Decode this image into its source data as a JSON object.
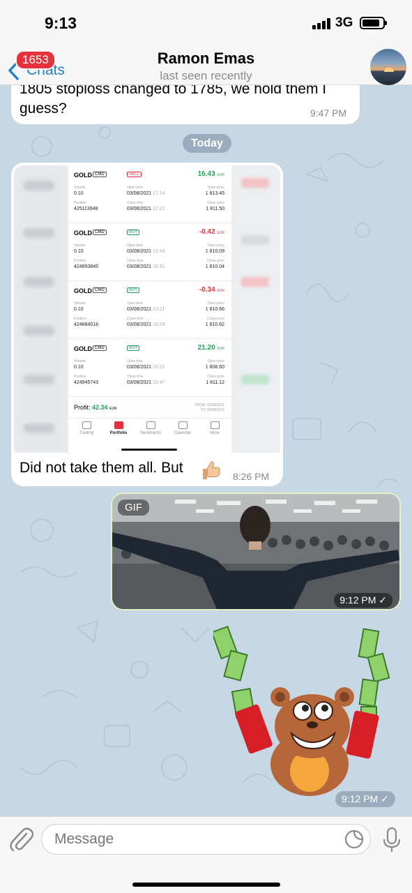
{
  "status_bar": {
    "time": "9:13",
    "network": "3G",
    "battery_level": 0.85
  },
  "header": {
    "back_label": "Chats",
    "unread_count": "1653",
    "title": "Ramon Emas",
    "subtitle": "last seen recently",
    "icons": {
      "back": "chevron-left-icon",
      "avatar": "sunset-photo"
    }
  },
  "messages": {
    "partial": {
      "text": "1805 stoploss changed to 1785, we hold them I guess?",
      "time": "9:47 PM"
    },
    "date_separator": "Today",
    "image_message": {
      "caption": "Did not take them all. But",
      "emoji": "thumbs-up-icon",
      "time": "8:26 PM",
      "screenshot": {
        "trades": [
          {
            "instrument": "GOLD",
            "type": "CMD",
            "side": "SELL",
            "pnl": "16.43",
            "currency": "EUR",
            "pnl_positive": true,
            "volume_label": "Volume",
            "volume": "0.10",
            "position_label": "Position",
            "position": "425113948",
            "open_time_label": "Open time",
            "open_date": "03/08/2021",
            "open_clock": "17:14",
            "close_time_label": "Close time",
            "close_date": "03/08/2021",
            "close_clock": "17:22",
            "open_price_label": "Open price",
            "open_price": "1 813.45",
            "close_price_label": "Close price",
            "close_price": "1 811.50"
          },
          {
            "instrument": "GOLD",
            "type": "CMD",
            "side": "BUY",
            "pnl": "-0.42",
            "currency": "EUR",
            "pnl_positive": false,
            "volume_label": "Volume",
            "volume": "0.10",
            "position_label": "Position",
            "position": "424893845",
            "open_time_label": "Open time",
            "open_date": "03/08/2021",
            "open_clock": "13:44",
            "close_time_label": "Close time",
            "close_date": "03/08/2021",
            "close_clock": "16:31",
            "open_price_label": "Open price",
            "open_price": "1 810.09",
            "close_price_label": "Close price",
            "close_price": "1 810.04"
          },
          {
            "instrument": "GOLD",
            "type": "CMD",
            "side": "BUY",
            "pnl": "-0.34",
            "currency": "EUR",
            "pnl_positive": false,
            "volume_label": "Volume",
            "volume": "0.10",
            "position_label": "Position",
            "position": "424884018",
            "open_time_label": "Open time",
            "open_date": "03/08/2021",
            "open_clock": "13:21",
            "close_time_label": "Close time",
            "close_date": "03/08/2021",
            "close_clock": "16:09",
            "open_price_label": "Open price",
            "open_price": "1 810.66",
            "close_price_label": "Close price",
            "close_price": "1 810.62"
          },
          {
            "instrument": "GOLD",
            "type": "CMD",
            "side": "BUY",
            "pnl": "21.20",
            "currency": "EUR",
            "pnl_positive": true,
            "volume_label": "Volume",
            "volume": "0.10",
            "position_label": "Position",
            "position": "424945743",
            "open_time_label": "Open time",
            "open_date": "03/08/2021",
            "open_clock": "15:21",
            "close_time_label": "Close time",
            "close_date": "03/08/2021",
            "close_clock": "15:47",
            "open_price_label": "Open price",
            "open_price": "1 808.60",
            "close_price_label": "Close price",
            "close_price": "1 811.12"
          }
        ],
        "profit_label": "Profit:",
        "profit_value": "42.34",
        "profit_currency": "EUR",
        "from_text": "FROM: 03/08/2021",
        "to_text": "TO: 03/08/2021",
        "tabs": [
          {
            "label": "Trading",
            "icon": "trading-icon",
            "active": false
          },
          {
            "label": "Portfolio",
            "icon": "portfolio-icon",
            "active": true
          },
          {
            "label": "Sentiments",
            "icon": "sentiments-icon",
            "active": false
          },
          {
            "label": "Calendar",
            "icon": "calendar-icon",
            "active": false
          },
          {
            "label": "More",
            "icon": "more-icon",
            "active": false
          }
        ]
      }
    },
    "gif_message": {
      "tag": "GIF",
      "time": "9:12 PM",
      "read_icon": "check-icon"
    },
    "sticker_message": {
      "time": "9:12 PM",
      "read_icon": "check-icon",
      "sticker": "bear-money-sticker"
    }
  },
  "composer": {
    "placeholder": "Message",
    "icons": {
      "attach": "paperclip-icon",
      "sticker": "sticker-icon",
      "mic": "microphone-icon"
    }
  },
  "colors": {
    "accent": "#2481cc",
    "badge": "#e6323c",
    "outgoing_border": "#e1f5c8",
    "profit_green": "#1fa25a",
    "loss_red": "#e0323c"
  }
}
